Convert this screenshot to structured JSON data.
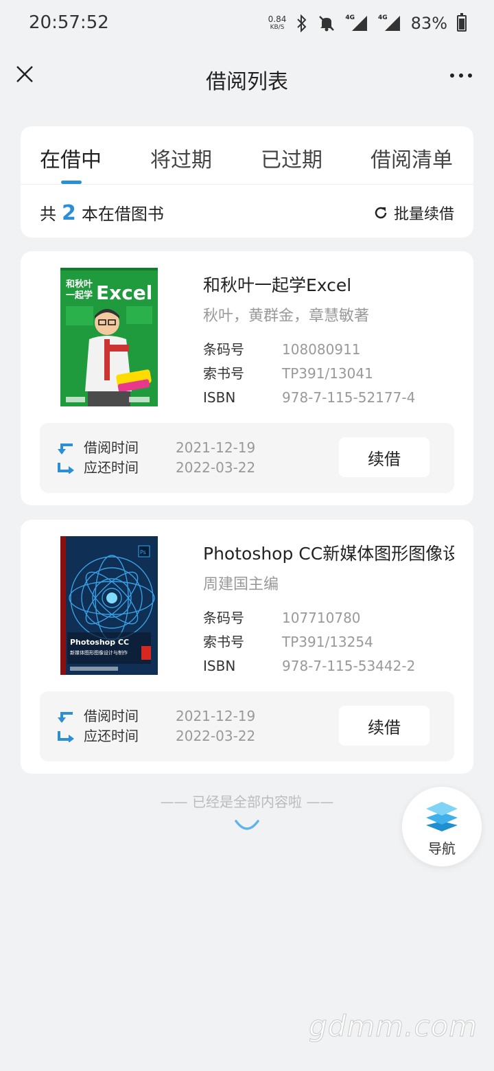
{
  "status_bar": {
    "time": "20:57:52",
    "net_speed": "0.84",
    "net_unit": "KB/S",
    "battery": "83%",
    "icons": [
      "bluetooth-icon",
      "mute-icon",
      "signal-4g-icon",
      "signal-4g-icon",
      "battery-icon"
    ]
  },
  "header": {
    "title": "借阅列表"
  },
  "tabs": [
    {
      "label": "在借中",
      "active": true
    },
    {
      "label": "将过期",
      "active": false
    },
    {
      "label": "已过期",
      "active": false
    },
    {
      "label": "借阅清单",
      "active": false
    }
  ],
  "summary": {
    "prefix": "共",
    "count": "2",
    "suffix": "本在借图书",
    "batch_renew": "批量续借"
  },
  "labels": {
    "barcode": "条码号",
    "call_number": "索书号",
    "isbn": "ISBN",
    "borrow_time": "借阅时间",
    "return_time": "应还时间",
    "renew": "续借"
  },
  "books": [
    {
      "title": "和秋叶一起学Excel",
      "author": "秋叶，黄群金，章慧敏著",
      "barcode": "108080911",
      "call_number": "TP391/13041",
      "isbn": "978-7-115-52177-4",
      "borrow_date": "2021-12-19",
      "return_date": "2022-03-22",
      "cover_text": {
        "line1": "和秋叶",
        "line2": "一起学",
        "word": "Excel"
      }
    },
    {
      "title": "Photoshop CC新媒体图形图像设计与制作",
      "author": "周建国主编",
      "barcode": "107710780",
      "call_number": "TP391/13254",
      "isbn": "978-7-115-53442-2",
      "borrow_date": "2021-12-19",
      "return_date": "2022-03-22",
      "cover_text": {
        "line1": "Photoshop CC",
        "line2": "新媒体图形图像设计与制作"
      }
    }
  ],
  "footer": {
    "end_note": "—— 已经是全部内容啦 ——"
  },
  "nav_button": {
    "label": "导航"
  },
  "watermark": "gdmm.com",
  "colors": {
    "accent": "#2b8fd6",
    "background": "#f1f2f4"
  }
}
